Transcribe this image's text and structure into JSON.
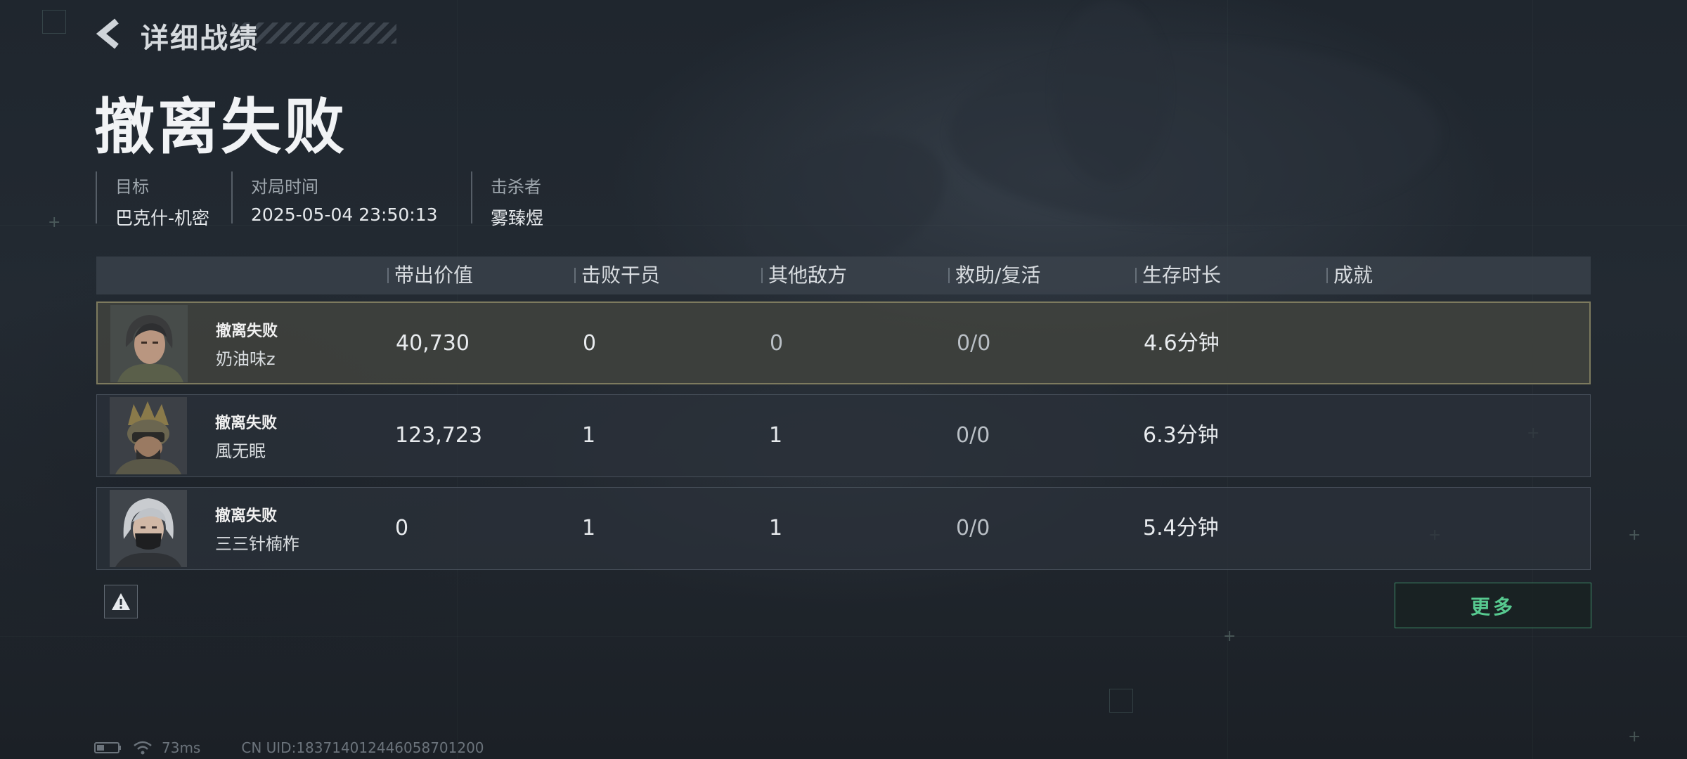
{
  "header": {
    "title": "详细战绩"
  },
  "page_title": "撤离失败",
  "info": [
    {
      "label": "目标",
      "value": "巴克什-机密"
    },
    {
      "label": "对局时间",
      "value": "2025-05-04 23:50:13"
    },
    {
      "label": "击杀者",
      "value": "雾臻煜"
    }
  ],
  "table": {
    "columns": [
      "带出价值",
      "击败干员",
      "其他敌方",
      "救助/复活",
      "生存时长",
      "成就"
    ],
    "rows": [
      {
        "status": "撤离失败",
        "name": "奶油味z",
        "value": "40,730",
        "kills": "0",
        "other": "0",
        "assist": "0/0",
        "survival": "4.6分钟",
        "achievement": ""
      },
      {
        "status": "撤离失败",
        "name": "風无眠",
        "value": "123,723",
        "kills": "1",
        "other": "1",
        "assist": "0/0",
        "survival": "6.3分钟",
        "achievement": ""
      },
      {
        "status": "撤离失败",
        "name": "三三针楠柞",
        "value": "0",
        "kills": "1",
        "other": "1",
        "assist": "0/0",
        "survival": "5.4分钟",
        "achievement": ""
      }
    ]
  },
  "buttons": {
    "more": "更多"
  },
  "status_bar": {
    "ping": "73ms",
    "uid": "CN UID:183714012446058701200"
  },
  "colors": {
    "accent_green": "#57c98f",
    "selected_border": "#7d7a5e"
  }
}
